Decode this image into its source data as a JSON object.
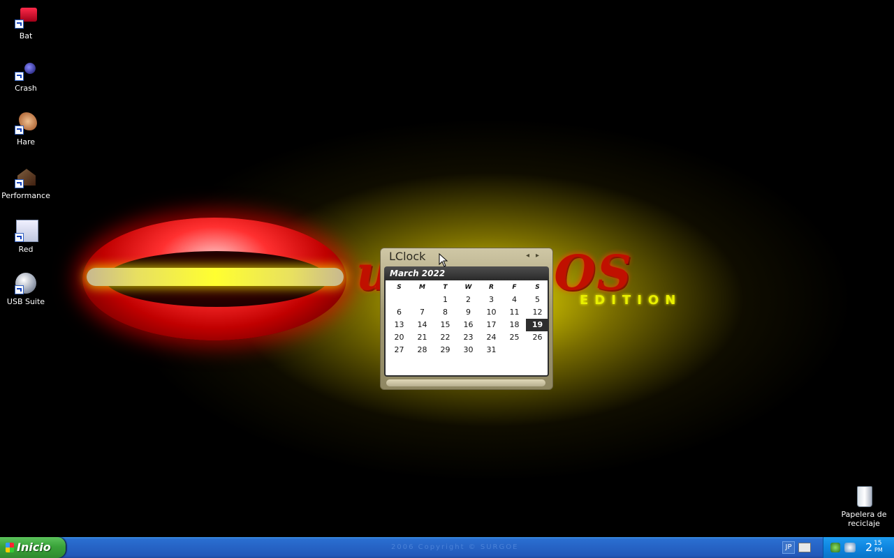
{
  "desktop": {
    "wallpaper": {
      "logo_text": "ubuntaOS",
      "logo_sub": "EDITION"
    },
    "icons": [
      {
        "label": "Bat",
        "icon": "bat-shortcut-icon"
      },
      {
        "label": "Crash",
        "icon": "crash-shortcut-icon"
      },
      {
        "label": "Hare",
        "icon": "hare-shortcut-icon"
      },
      {
        "label": "Performance",
        "icon": "performance-shortcut-icon"
      },
      {
        "label": "Red",
        "icon": "network-shortcut-icon"
      },
      {
        "label": "USB Suite",
        "icon": "usb-suite-shortcut-icon"
      }
    ],
    "recycle_bin": {
      "label": "Papelera de reciclaje",
      "icon": "recycle-bin-icon"
    }
  },
  "lclock": {
    "title": "LClock",
    "prev": "◂",
    "next": "▸",
    "month_label": "March 2022",
    "weekdays": [
      "S",
      "M",
      "T",
      "W",
      "R",
      "F",
      "S"
    ],
    "days": [
      "",
      "",
      "1",
      "2",
      "3",
      "4",
      "5",
      "6",
      "7",
      "8",
      "9",
      "10",
      "11",
      "12",
      "13",
      "14",
      "15",
      "16",
      "17",
      "18",
      "19",
      "20",
      "21",
      "22",
      "23",
      "24",
      "25",
      "26",
      "27",
      "28",
      "29",
      "30",
      "31"
    ],
    "today": "19"
  },
  "taskbar": {
    "start_label": "Inicio",
    "watermark": "2006 Copyright © SURGOE",
    "language": "JP",
    "clock": {
      "hour": "2",
      "minute": "15",
      "ampm": "PM"
    },
    "colors": {
      "bar": "#2663c5",
      "start": "#3aa33a",
      "tray": "#0f86e0"
    }
  }
}
